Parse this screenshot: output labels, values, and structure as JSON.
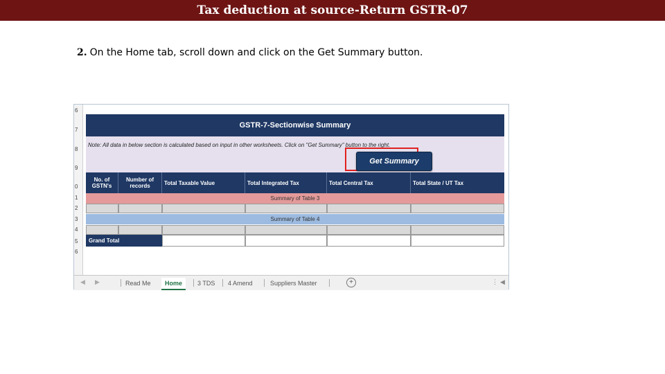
{
  "header": {
    "title": "Tax deduction at source-Return GSTR-07"
  },
  "instruction": {
    "number": "2.",
    "text": "On the Home tab, scroll down and click on the Get Summary button."
  },
  "sheet": {
    "row_numbers": [
      "6",
      "7",
      "8",
      "9",
      "0",
      "1",
      "2",
      "3",
      "4",
      "5",
      "6"
    ],
    "title": "GSTR-7-Sectionwise Summary",
    "note": "Note: All data in below section is calculated based on input in other worksheets. Click on \"Get Summary\" button to the right.",
    "get_summary_label": "Get Summary",
    "columns": [
      "No. of GSTN's",
      "Number of records",
      "Total Taxable Value",
      "Total Integrated Tax",
      "Total Central Tax",
      "Total State / UT Tax"
    ],
    "band_table3": "Summary of Table 3",
    "band_table4": "Summary of Table 4",
    "grand_total": "Grand Total",
    "colors": {
      "header_navy": "#1f3864",
      "table3_band": "#e49a9a",
      "table4_band": "#9dbbe0",
      "note_bg": "#e6e0ee",
      "highlight": "#e02020"
    }
  },
  "tabs": {
    "items": [
      "Read Me",
      "Home",
      "3 TDS",
      "4 Amend",
      "Suppliers Master"
    ],
    "active": "Home"
  }
}
